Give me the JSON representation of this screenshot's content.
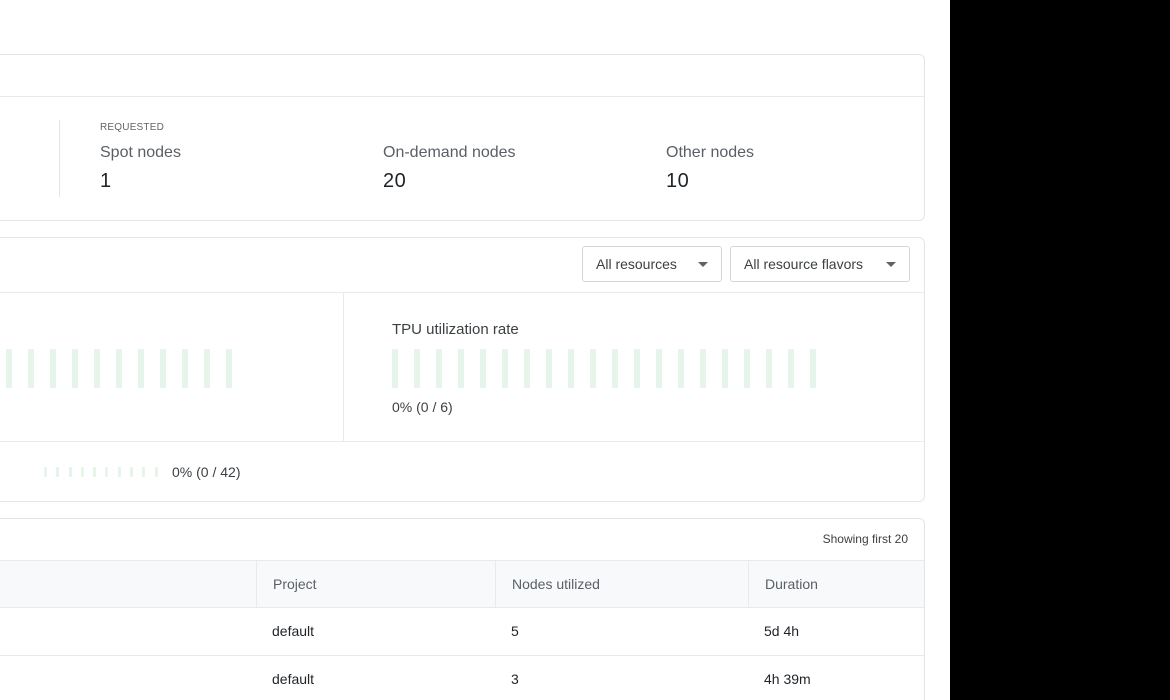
{
  "node_summary": {
    "eyebrow": "REQUESTED",
    "spot": {
      "label": "Spot nodes",
      "value": "1"
    },
    "on_demand": {
      "label": "On-demand nodes",
      "value": "20"
    },
    "other": {
      "label": "Other nodes",
      "value": "10"
    }
  },
  "utilization": {
    "filters": {
      "resources": {
        "selected": "All resources"
      },
      "flavors": {
        "selected": "All resource flavors"
      }
    },
    "left_bar_count": 11,
    "tpu": {
      "title": "TPU utilization rate",
      "value": "0% (0 / 6)",
      "bar_count": 20,
      "fraction": 0
    },
    "bottom": {
      "value": "0% (0 / 42)",
      "bar_count": 10,
      "fraction": 0
    },
    "bar_color": "#e6f4ea"
  },
  "table": {
    "showing_text": "Showing first 20",
    "columns": [
      "Project",
      "Nodes utilized",
      "Duration"
    ],
    "rows": [
      {
        "project": "default",
        "nodes": "5",
        "duration": "5d 4h"
      },
      {
        "project": "default",
        "nodes": "3",
        "duration": "4h 39m"
      }
    ]
  }
}
